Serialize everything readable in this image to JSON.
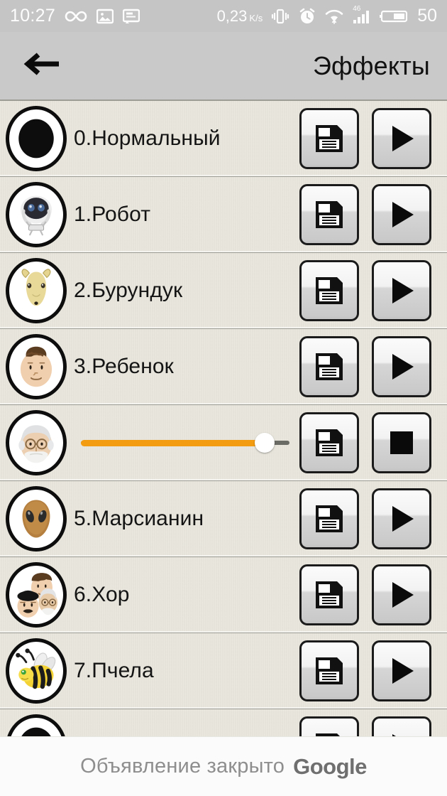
{
  "status_bar": {
    "time": "10:27",
    "data_rate": "0,23",
    "data_rate_unit_num": "K",
    "data_rate_unit_den": "s",
    "network_badge": "46",
    "battery_percent": "50",
    "icons": [
      "infinity-icon",
      "image-icon",
      "screenshot-icon",
      "vibrate-icon",
      "alarm-icon",
      "wifi-icon",
      "signal-icon",
      "battery-icon"
    ]
  },
  "action_bar": {
    "back_icon": "back-arrow-icon",
    "title": "Эффекты"
  },
  "ui": {
    "accent_color": "#f39c12",
    "background_color": "#e9e7dd",
    "header_color": "#c9c9c9",
    "status_bar_color": "#c5c5c5"
  },
  "list": {
    "rows": [
      {
        "id": 0,
        "label": "0.Нормальный",
        "avatar": "black-circle-avatar",
        "playing": false,
        "save_icon": "floppy-disk-icon",
        "action_icon": "play-icon"
      },
      {
        "id": 1,
        "label": "1.Робот",
        "avatar": "robot-avatar",
        "playing": false,
        "save_icon": "floppy-disk-icon",
        "action_icon": "play-icon"
      },
      {
        "id": 2,
        "label": "2.Бурундук",
        "avatar": "chipmunk-avatar",
        "playing": false,
        "save_icon": "floppy-disk-icon",
        "action_icon": "play-icon"
      },
      {
        "id": 3,
        "label": "3.Ребенок",
        "avatar": "baby-avatar",
        "playing": false,
        "save_icon": "floppy-disk-icon",
        "action_icon": "play-icon"
      },
      {
        "id": 4,
        "label": "",
        "avatar": "old-man-avatar",
        "playing": true,
        "progress_percent": 88,
        "save_icon": "floppy-disk-icon",
        "action_icon": "stop-icon"
      },
      {
        "id": 5,
        "label": "5.Марсианин",
        "avatar": "alien-avatar",
        "playing": false,
        "save_icon": "floppy-disk-icon",
        "action_icon": "play-icon"
      },
      {
        "id": 6,
        "label": "6.Хор",
        "avatar": "chorus-avatar",
        "playing": false,
        "save_icon": "floppy-disk-icon",
        "action_icon": "play-icon"
      },
      {
        "id": 7,
        "label": "7.Пчела",
        "avatar": "bee-avatar",
        "playing": false,
        "save_icon": "floppy-disk-icon",
        "action_icon": "play-icon"
      },
      {
        "id": 8,
        "label": "",
        "avatar": "black-circle-avatar",
        "playing": false,
        "save_icon": "floppy-disk-icon",
        "action_icon": "play-icon",
        "partial": true
      }
    ]
  },
  "ad": {
    "text": "Объявление закрыто",
    "brand": "Google"
  }
}
